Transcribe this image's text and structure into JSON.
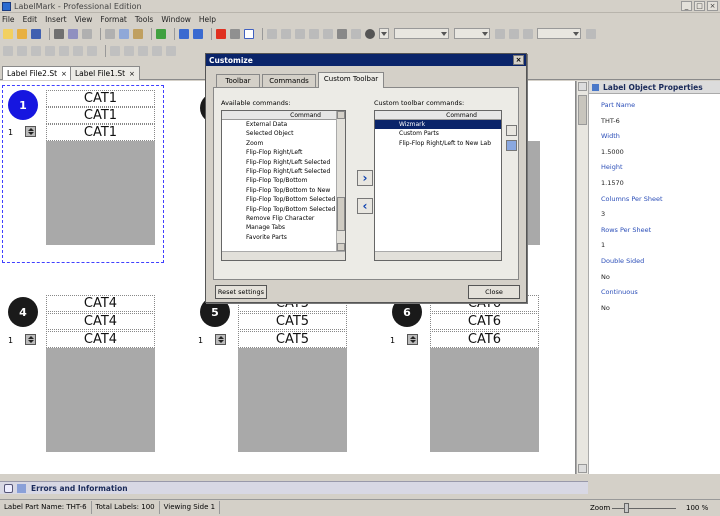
{
  "window": {
    "title": "LabelMark - Professional Edition"
  },
  "menu": [
    "File",
    "Edit",
    "Insert",
    "View",
    "Format",
    "Tools",
    "Window",
    "Help"
  ],
  "doc_tabs": [
    {
      "label": "Label File2.St",
      "active": true
    },
    {
      "label": "Label File1.St",
      "active": false
    }
  ],
  "labels": [
    {
      "number": "1",
      "rows": [
        "CAT1",
        "CAT1",
        "CAT1"
      ],
      "copies": "1",
      "selected": true
    },
    {
      "number": "4",
      "rows": [
        "CAT4",
        "CAT4",
        "CAT4"
      ],
      "copies": "1",
      "selected": false
    },
    {
      "number": "5",
      "rows": [
        "CAT5",
        "CAT5",
        "CAT5"
      ],
      "copies": "1",
      "selected": false
    },
    {
      "number": "6",
      "rows": [
        "CAT6",
        "CAT6",
        "CAT6"
      ],
      "copies": "1",
      "selected": false
    }
  ],
  "properties_panel": {
    "title": "Label Object Properties",
    "fields": [
      {
        "key": "Part Name",
        "value": "THT-6"
      },
      {
        "key": "Width",
        "value": "1.5000"
      },
      {
        "key": "Height",
        "value": "1.1570"
      },
      {
        "key": "Columns Per Sheet",
        "value": "3"
      },
      {
        "key": "Rows Per Sheet",
        "value": "1"
      },
      {
        "key": "Double Sided",
        "value": "No"
      },
      {
        "key": "Continuous",
        "value": "No"
      }
    ]
  },
  "dialog": {
    "title": "Customize",
    "tabs": [
      "Toolbar",
      "Commands",
      "Custom Toolbar"
    ],
    "available_label": "Available commands:",
    "custom_label": "Custom toolbar commands:",
    "column_header": "Command",
    "available_commands": [
      "External Data",
      "Selected Object",
      "Zoom",
      "Flip-Flop Right/Left",
      "Flip-Flop Right/Left Selected",
      "Flip-Flop Right/Left Selected",
      "Flip-Flop Top/Bottom",
      "Flip-Flop Top/Bottom to New",
      "Flip-Flop Top/Bottom Selected",
      "Flip-Flop Top/Bottom Selected",
      "Remove Flip Character",
      "Manage Tabs",
      "Favorite Parts"
    ],
    "custom_commands": [
      "Wizmark",
      "Custom Parts",
      "Flip-Flop Right/Left to New Lab"
    ],
    "reset_label": "Reset settings",
    "close_label": "Close",
    "add_arrow": "›",
    "remove_arrow": "‹"
  },
  "errors_panel": {
    "title": "Errors and Information"
  },
  "status": {
    "part_name": "Label Part Name: THT-6",
    "total_labels": "Total Labels: 100",
    "viewing_side": "Viewing Side 1",
    "zoom_label": "Zoom",
    "zoom_value": "100 %"
  },
  "colors": {
    "selected_label": "#1616e0",
    "title_bar": "#0a246a",
    "label_body": "#a9a9a9"
  }
}
